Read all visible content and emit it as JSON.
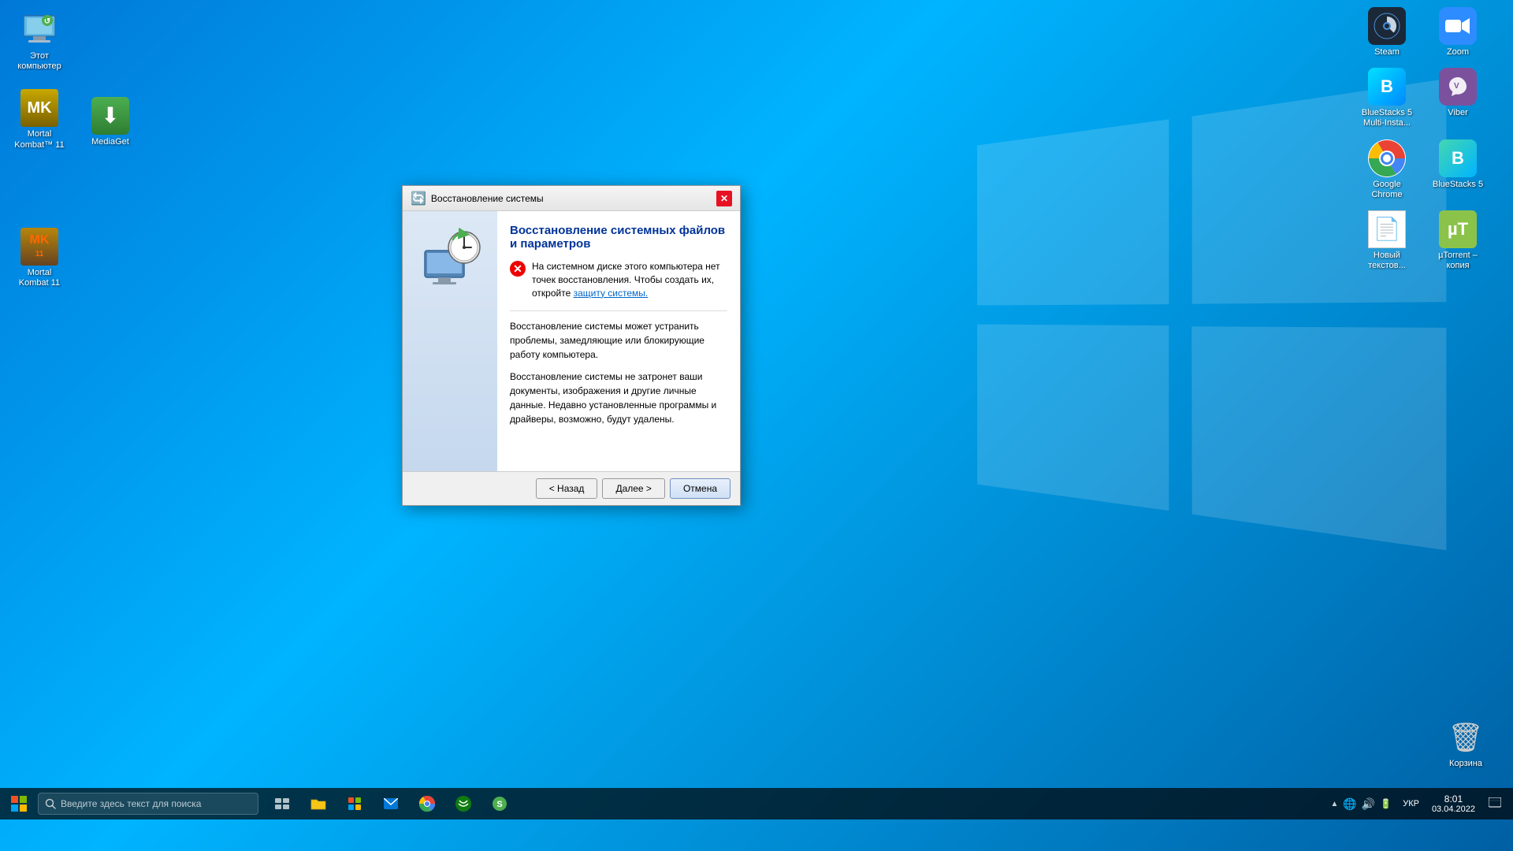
{
  "desktop": {
    "background": "blue gradient",
    "icons_left": [
      {
        "id": "my-computer",
        "label": "Этот\nкомпьютер",
        "icon": "💻"
      },
      {
        "id": "mortal-kombat-11-top",
        "label": "Mortal\nKombat™ 11",
        "icon": "MK"
      },
      {
        "id": "mediaget",
        "label": "MediaGet",
        "icon": "⬇"
      },
      {
        "id": "mortal-kombat-11-bottom",
        "label": "Mortal\nKombat 11",
        "icon": "🎮"
      }
    ],
    "icons_right": [
      {
        "id": "steam",
        "label": "Steam",
        "icon": "♨"
      },
      {
        "id": "zoom",
        "label": "Zoom",
        "icon": "Z"
      },
      {
        "id": "bluestacks5-multi",
        "label": "BlueStacks 5\nMulti-Insta...",
        "icon": "B"
      },
      {
        "id": "viber",
        "label": "Viber",
        "icon": "V"
      },
      {
        "id": "google-chrome",
        "label": "Google\nChrome",
        "icon": "●"
      },
      {
        "id": "bluestacks5",
        "label": "BlueStacks 5",
        "icon": "B"
      },
      {
        "id": "new-text",
        "label": "Новый\nтекстов...",
        "icon": "📄"
      },
      {
        "id": "utorrent",
        "label": "µTorrent –\nкопия",
        "icon": "µ"
      }
    ],
    "recycle_bin": {
      "label": "Корзина",
      "icon": "🗑"
    }
  },
  "dialog": {
    "title": "Восстановление системы",
    "close_button": "✕",
    "main_heading": "Восстановление системных файлов и параметров",
    "error_message": "На системном диске этого компьютера нет точек восстановления. Чтобы создать их, откройте",
    "error_link": "защиту системы.",
    "info_text_1": "Восстановление системы может устранить проблемы, замедляющие или блокирующие работу компьютера.",
    "info_text_2": "Восстановление системы не затронет ваши документы, изображения и другие личные данные. Недавно установленные программы и драйверы, возможно, будут удалены.",
    "buttons": {
      "back": "< Назад",
      "next": "Далее >",
      "cancel": "Отмена"
    }
  },
  "taskbar": {
    "search_placeholder": "Введите здесь текст для поиска",
    "time": "8:01",
    "date": "03.04.2022",
    "lang": "УКР"
  }
}
